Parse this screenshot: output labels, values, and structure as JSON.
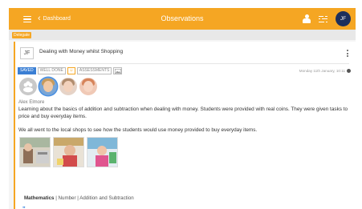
{
  "header": {
    "back_label": "Dashboard",
    "title": "Observations",
    "avatar_initials": "JF"
  },
  "tag": "Delegate",
  "card": {
    "initials": "JF",
    "title": "Dealing with Money whilst Shopping",
    "chips": [
      "SAVED",
      "WELL DONE",
      "☺",
      "ASSESSMENTS"
    ],
    "date": "Monday 11th January, 10:11",
    "author": "Alex Elmore",
    "body": "Learning about the basics of addition and subtraction when dealing with money. Students were provided with real coins. They were given tasks to price and buy everyday items.",
    "body2": "We all went to the local shops to see how the students would use money provided to buy everyday items.",
    "curriculum_subject": "Mathematics",
    "curriculum_path": " | Number | Addition and Subtraction",
    "note_mark": "❞"
  },
  "colors": {
    "accent": "#f5a623",
    "avatar": "#1d2f5c",
    "saved_chip": "#3b7fd4",
    "selection": "#4a90e2"
  },
  "icons": [
    "menu-icon",
    "chevron-left-icon",
    "person-icon",
    "filter-icon",
    "more-vertical-icon",
    "globe-icon",
    "image-icon",
    "smiley-icon",
    "group-icon",
    "quote-icon"
  ]
}
